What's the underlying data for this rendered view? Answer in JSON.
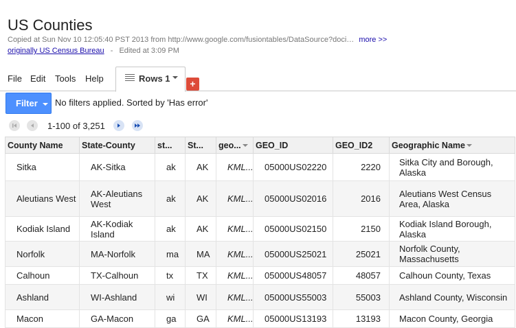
{
  "header": {
    "title": "US Counties",
    "copied_text": "Copied at Sun Nov 10 12:05:40 PST 2013 from http://www.google.com/fusiontables/DataSource?doci…",
    "more_link": "more >>",
    "source_link": "originally US Census Bureau",
    "separator": "-",
    "edited_text": "Edited at 3:09 PM"
  },
  "menu": {
    "file": "File",
    "edit": "Edit",
    "tools": "Tools",
    "help": "Help"
  },
  "tabs": [
    {
      "label": "Rows 1",
      "icon": "list-icon"
    }
  ],
  "add_tab_label": "+",
  "filter": {
    "button_label": "Filter",
    "status_text": "No filters applied. Sorted by 'Has error'"
  },
  "pager": {
    "range_text": "1-100 of 3,251"
  },
  "table": {
    "columns": [
      "County Name",
      "State-County",
      "st...",
      "St...",
      "geo...",
      "GEO_ID",
      "GEO_ID2",
      "Geographic Name"
    ],
    "rows": [
      [
        "Sitka",
        "AK-Sitka",
        "ak",
        "AK",
        "KML...",
        "05000US02220",
        "2220",
        "Sitka City and Borough, Alaska"
      ],
      [
        "Aleutians West",
        "AK-Aleutians West",
        "ak",
        "AK",
        "KML...",
        "05000US02016",
        "2016",
        "Aleutians West Census Area, Alaska"
      ],
      [
        "Kodiak Island",
        "AK-Kodiak Island",
        "ak",
        "AK",
        "KML...",
        "05000US02150",
        "2150",
        "Kodiak Island Borough, Alaska"
      ],
      [
        "Norfolk",
        "MA-Norfolk",
        "ma",
        "MA",
        "KML...",
        "05000US25021",
        "25021",
        "Norfolk County, Massachusetts"
      ],
      [
        "Calhoun",
        "TX-Calhoun",
        "tx",
        "TX",
        "KML...",
        "05000US48057",
        "48057",
        "Calhoun County, Texas"
      ],
      [
        "Ashland",
        "WI-Ashland",
        "wi",
        "WI",
        "KML...",
        "05000US55003",
        "55003",
        "Ashland County, Wisconsin"
      ],
      [
        "Macon",
        "GA-Macon",
        "ga",
        "GA",
        "KML...",
        "05000US13193",
        "13193",
        "Macon County, Georgia"
      ]
    ]
  },
  "colors": {
    "filter_button": "#4d90fe",
    "add_tab": "#dd4b39",
    "link": "#1a0dab"
  }
}
